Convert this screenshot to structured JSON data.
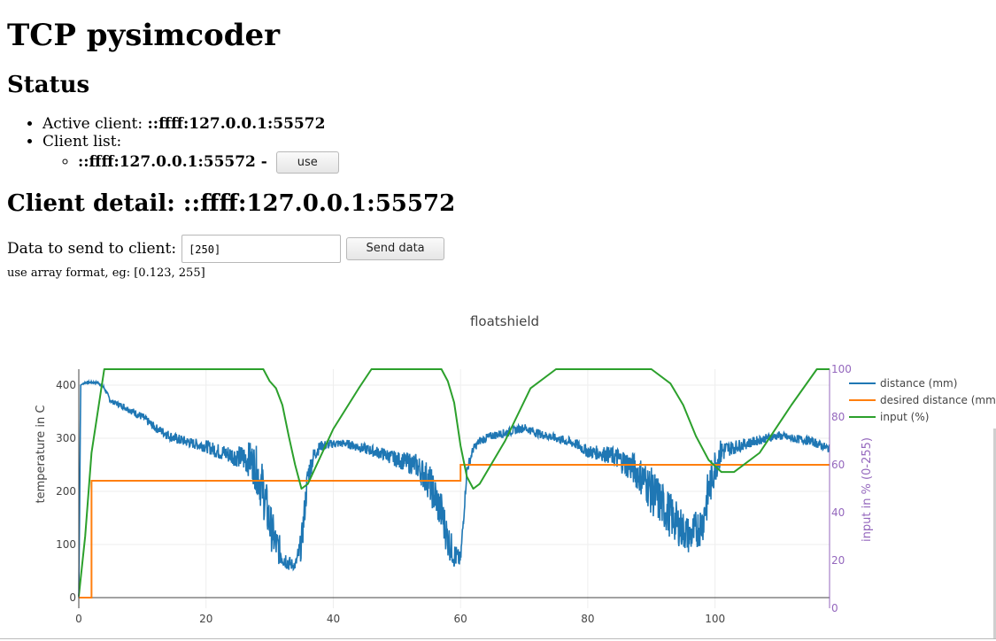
{
  "page": {
    "title": "TCP pysimcoder",
    "status_heading": "Status",
    "active_client_label": "Active client: ",
    "active_client": "::ffff:127.0.0.1:55572",
    "client_list_label": "Client list:",
    "clients": [
      {
        "address": "::ffff:127.0.0.1:55572",
        "separator": " - ",
        "button_label": "use"
      }
    ],
    "detail_heading": "Client detail: ::ffff:127.0.0.1:55572",
    "send_label": "Data to send to client:",
    "send_value": "[250]",
    "send_button": "Send data",
    "hint": "use array format, eg: [0.123, 255]"
  },
  "chart_data": {
    "type": "line",
    "title": "floatshield",
    "ylabel": "temperature in C",
    "y2label": "input in % (0-255)",
    "xlim": [
      0,
      118
    ],
    "ylim": [
      -20,
      430
    ],
    "y2lim": [
      0,
      100
    ],
    "xticks": [
      0,
      20,
      40,
      60,
      80,
      100
    ],
    "yticks": [
      0,
      100,
      200,
      300,
      400
    ],
    "y2ticks": [
      0,
      20,
      40,
      60,
      80,
      100
    ],
    "grid": true,
    "legend": "top-right",
    "colors": {
      "distance": "#1f77b4",
      "desired": "#ff7f0e",
      "input": "#2ca02c",
      "y2axis": "#9467bd"
    },
    "series": [
      {
        "name": "distance (mm)",
        "axis": "y",
        "x": [
          0,
          0.3,
          1,
          3,
          4,
          5,
          7,
          10,
          12,
          15,
          18,
          20,
          22,
          25,
          27,
          28,
          29,
          30,
          31,
          32,
          33,
          34,
          35,
          36,
          37,
          38,
          40,
          42,
          45,
          48,
          50,
          53,
          55,
          57,
          58,
          59,
          60,
          61,
          62,
          63,
          65,
          67,
          70,
          72,
          75,
          78,
          80,
          83,
          85,
          87,
          89,
          90,
          92,
          94,
          96,
          98,
          99,
          100,
          101,
          102,
          105,
          108,
          110,
          112,
          115,
          118
        ],
        "y": [
          0,
          400,
          405,
          405,
          395,
          370,
          360,
          340,
          320,
          300,
          290,
          285,
          275,
          265,
          260,
          240,
          200,
          140,
          100,
          80,
          65,
          60,
          100,
          230,
          270,
          285,
          290,
          290,
          280,
          270,
          260,
          250,
          220,
          160,
          110,
          80,
          70,
          240,
          280,
          295,
          305,
          310,
          320,
          310,
          300,
          290,
          275,
          270,
          260,
          245,
          220,
          200,
          170,
          140,
          115,
          140,
          200,
          250,
          275,
          280,
          290,
          300,
          305,
          300,
          295,
          280
        ],
        "noise": [
          0,
          0,
          2,
          2,
          4,
          4,
          6,
          8,
          8,
          10,
          10,
          12,
          15,
          20,
          35,
          45,
          50,
          45,
          35,
          25,
          15,
          8,
          30,
          25,
          15,
          10,
          8,
          8,
          10,
          12,
          15,
          22,
          35,
          40,
          35,
          25,
          15,
          10,
          8,
          8,
          8,
          8,
          8,
          8,
          8,
          10,
          12,
          15,
          22,
          30,
          38,
          45,
          45,
          40,
          35,
          40,
          45,
          35,
          25,
          15,
          10,
          8,
          8,
          8,
          8,
          8
        ]
      },
      {
        "name": "desired distance (mm)",
        "axis": "y",
        "x": [
          0,
          2,
          2,
          60,
          60,
          118
        ],
        "y": [
          0,
          0,
          220,
          220,
          250,
          250
        ]
      },
      {
        "name": "input (%)",
        "axis": "y2",
        "x": [
          0,
          1,
          2,
          4,
          5,
          29,
          30,
          31,
          32,
          33,
          34,
          35,
          36,
          40,
          44,
          46,
          57,
          58,
          59,
          60,
          61,
          62,
          63,
          67,
          71,
          75,
          90,
          93,
          95,
          97,
          99,
          101,
          103,
          107,
          112,
          116,
          118
        ],
        "y": [
          5,
          30,
          65,
          100,
          100,
          100,
          95,
          92,
          85,
          72,
          60,
          50,
          52,
          75,
          92,
          100,
          100,
          95,
          86,
          68,
          55,
          50,
          52,
          70,
          92,
          100,
          100,
          94,
          85,
          72,
          62,
          57,
          57,
          65,
          85,
          100,
          100
        ]
      }
    ]
  }
}
